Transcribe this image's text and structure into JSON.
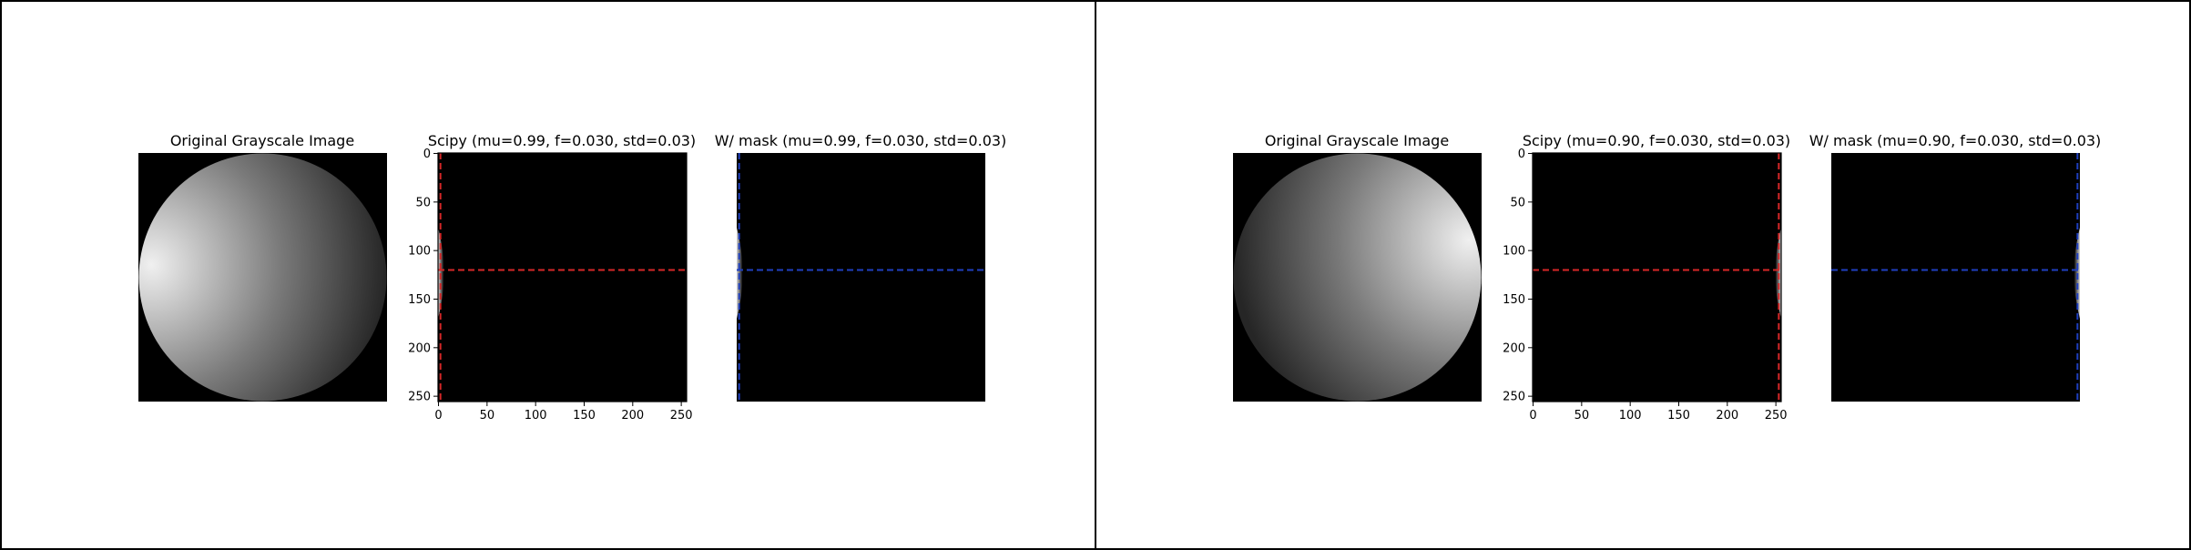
{
  "colors": {
    "hline_scipy": "#d62728",
    "vline_scipy": "#d62728",
    "lines_mask": "#1f3fbf",
    "image_bg": "#000000"
  },
  "chart_data": [
    {
      "type": "image",
      "panel": "left",
      "subplots": [
        {
          "kind": "disk",
          "title": "Original Grayscale Image",
          "axis_visible": false,
          "light_side": "left"
        },
        {
          "kind": "slice",
          "title": "Scipy (mu=0.99, f=0.030, std=0.03)",
          "axis_visible": true,
          "xlim": [
            0,
            255
          ],
          "ylim": [
            255,
            0
          ],
          "xticks": [
            0,
            50,
            100,
            150,
            200,
            250
          ],
          "yticks": [
            0,
            50,
            100,
            150,
            200,
            250
          ],
          "hline_y": 120,
          "vline_x": 2,
          "line_color": "red",
          "edge": "left"
        },
        {
          "kind": "slice",
          "title": "W/ mask (mu=0.99, f=0.030, std=0.03)",
          "axis_visible": false,
          "xlim": [
            0,
            255
          ],
          "ylim": [
            255,
            0
          ],
          "hline_y": 120,
          "vline_x": 2,
          "line_color": "blue",
          "edge": "left"
        }
      ]
    },
    {
      "type": "image",
      "panel": "right",
      "subplots": [
        {
          "kind": "disk",
          "title": "Original Grayscale Image",
          "axis_visible": false,
          "light_side": "right"
        },
        {
          "kind": "slice",
          "title": "Scipy (mu=0.90, f=0.030, std=0.03)",
          "axis_visible": true,
          "xlim": [
            0,
            255
          ],
          "ylim": [
            255,
            0
          ],
          "xticks": [
            0,
            50,
            100,
            150,
            200,
            250
          ],
          "yticks": [
            0,
            50,
            100,
            150,
            200,
            250
          ],
          "hline_y": 120,
          "vline_x": 253,
          "line_color": "red",
          "edge": "right"
        },
        {
          "kind": "slice",
          "title": "W/ mask (mu=0.90, f=0.030, std=0.03)",
          "axis_visible": false,
          "xlim": [
            0,
            255
          ],
          "ylim": [
            255,
            0
          ],
          "hline_y": 120,
          "vline_x": 253,
          "line_color": "blue",
          "edge": "right"
        }
      ]
    }
  ]
}
